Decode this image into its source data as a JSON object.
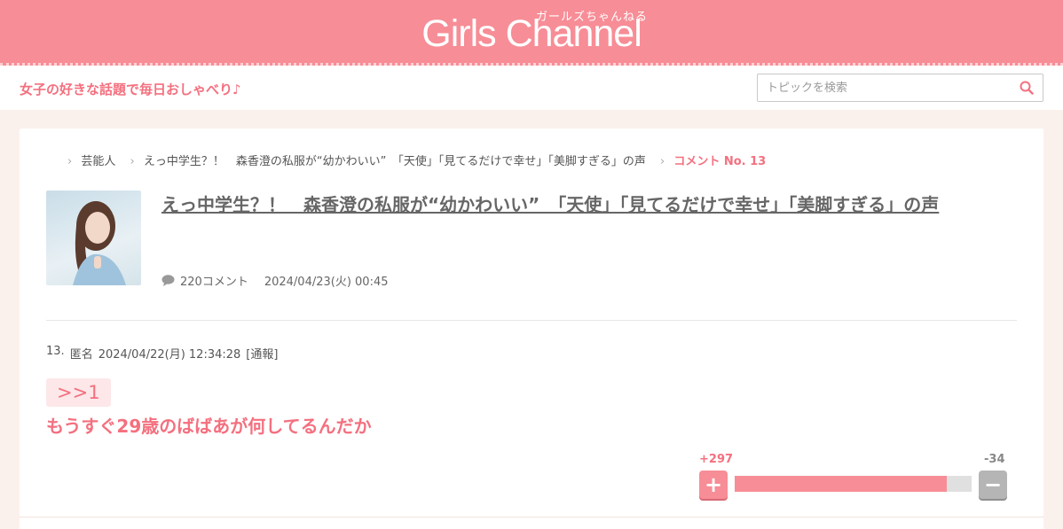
{
  "site": {
    "logo": "Girls Channel",
    "logo_sub": "ガールズちゃんねる",
    "tagline": "女子の好きな話題で毎日おしゃべり♪",
    "search_placeholder": "トピックを検索"
  },
  "breadcrumb": {
    "category": "芸能人",
    "topic": "えっ中学生？！　森香澄の私服が“幼かわいい”　「天使」「見てるだけで幸せ」「美脚すぎる」の声",
    "current": "コメント No. 13"
  },
  "topic": {
    "title": "えっ中学生？！　森香澄の私服が“幼かわいい”　「天使」「見てるだけで幸せ」「美脚すぎる」の声",
    "comment_count": "220コメント",
    "date": "2024/04/23(火) 00:45"
  },
  "comment": {
    "number": "13.",
    "author": "匿名",
    "datetime": "2024/04/22(月) 12:34:28",
    "report": "[通報]",
    "anchor": ">>1",
    "body": "もうすぐ29歳のばばあが何してるんだか",
    "plus_count": "+297",
    "minus_count": "-34",
    "plus_ratio": 0.897
  },
  "colors": {
    "brand_pink": "#f78d96",
    "accent_text": "#f4707f"
  }
}
